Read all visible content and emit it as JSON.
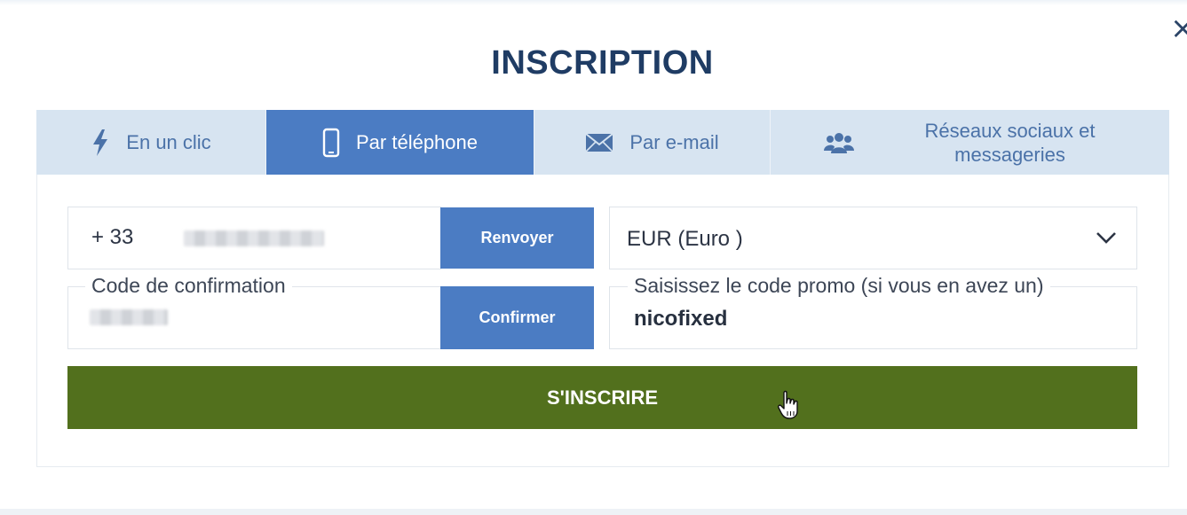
{
  "dialog": {
    "title": "INSCRIPTION",
    "close_glyph": "×"
  },
  "tabs": [
    {
      "label": "En un clic",
      "icon": "lightning-icon",
      "active": false
    },
    {
      "label": "Par téléphone",
      "icon": "smartphone-icon",
      "active": true
    },
    {
      "label": "Par e-mail",
      "icon": "envelope-icon",
      "active": false
    },
    {
      "label": "Réseaux sociaux et messageries",
      "icon": "users-group-icon",
      "active": false
    }
  ],
  "form": {
    "phone": {
      "country_code": "+ 33",
      "number_blurred": true
    },
    "resend_label": "Renvoyer",
    "currency": {
      "selected": "EUR (Euro )"
    },
    "confirmation_code": {
      "label": "Code de confirmation",
      "value_blurred": true
    },
    "confirm_label": "Confirmer",
    "promo": {
      "label": "Saisissez le code promo (si vous en avez un)",
      "value": "nicofixed"
    },
    "submit_label": "S'INSCRIRE"
  },
  "colors": {
    "title": "#1f3c64",
    "tab_bg": "#d7e4f1",
    "tab_active": "#4b7cc3",
    "tab_text": "#4b72a8",
    "button_blue": "#4b7cc3",
    "submit_green": "#52701d"
  }
}
